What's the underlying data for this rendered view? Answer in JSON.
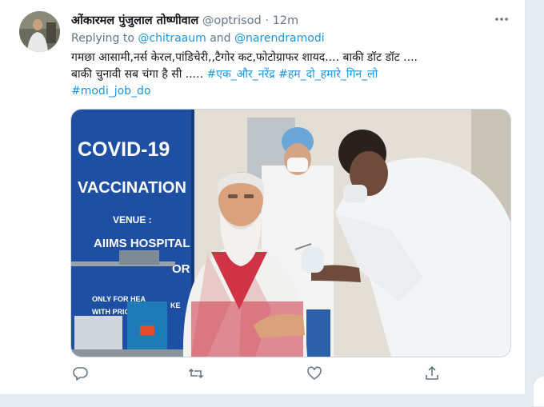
{
  "tweet": {
    "author_name": "ओंकारमल पुंजुलाल तोष्णीवाल",
    "handle": "@optrisod",
    "separator": " · ",
    "time": "12m",
    "replying_to_label": "Replying to ",
    "mention_1": "@chitraaum",
    "and_label": " and ",
    "mention_2": "@narendramodi",
    "text_line_1": "गमछा आसामी,नर्स केरल,पांडिचेरी,,टैगोर कट,फोटोग्राफर शायद.... बाकी डॉट डॉट ....",
    "text_line_2": "बाकी चुनावी सब चंगा है सी ..... ",
    "hashtag_1": "#एक_और_नरेंद्र",
    "hashtag_2": "#हम_दो_हमारे_गिन_लो",
    "hashtag_3": "#modi_job_do"
  },
  "photo": {
    "banner_line_1": "COVID-19",
    "banner_line_2": "VACCINATION",
    "banner_line_3": "VENUE :",
    "banner_line_4": "AIIMS HOSPITAL",
    "banner_line_5": "OR",
    "banner_line_6": "ONLY FOR HEA",
    "banner_line_7": "WITH PRIOR",
    "banner_line_8": "KE"
  },
  "icons": {
    "more": "more-options-icon",
    "reply": "reply-icon",
    "retweet": "retweet-icon",
    "like": "like-icon",
    "share": "share-icon"
  },
  "colors": {
    "link": "#1b95e0",
    "muted": "#657786",
    "banner_blue": "#1f4fa3"
  }
}
